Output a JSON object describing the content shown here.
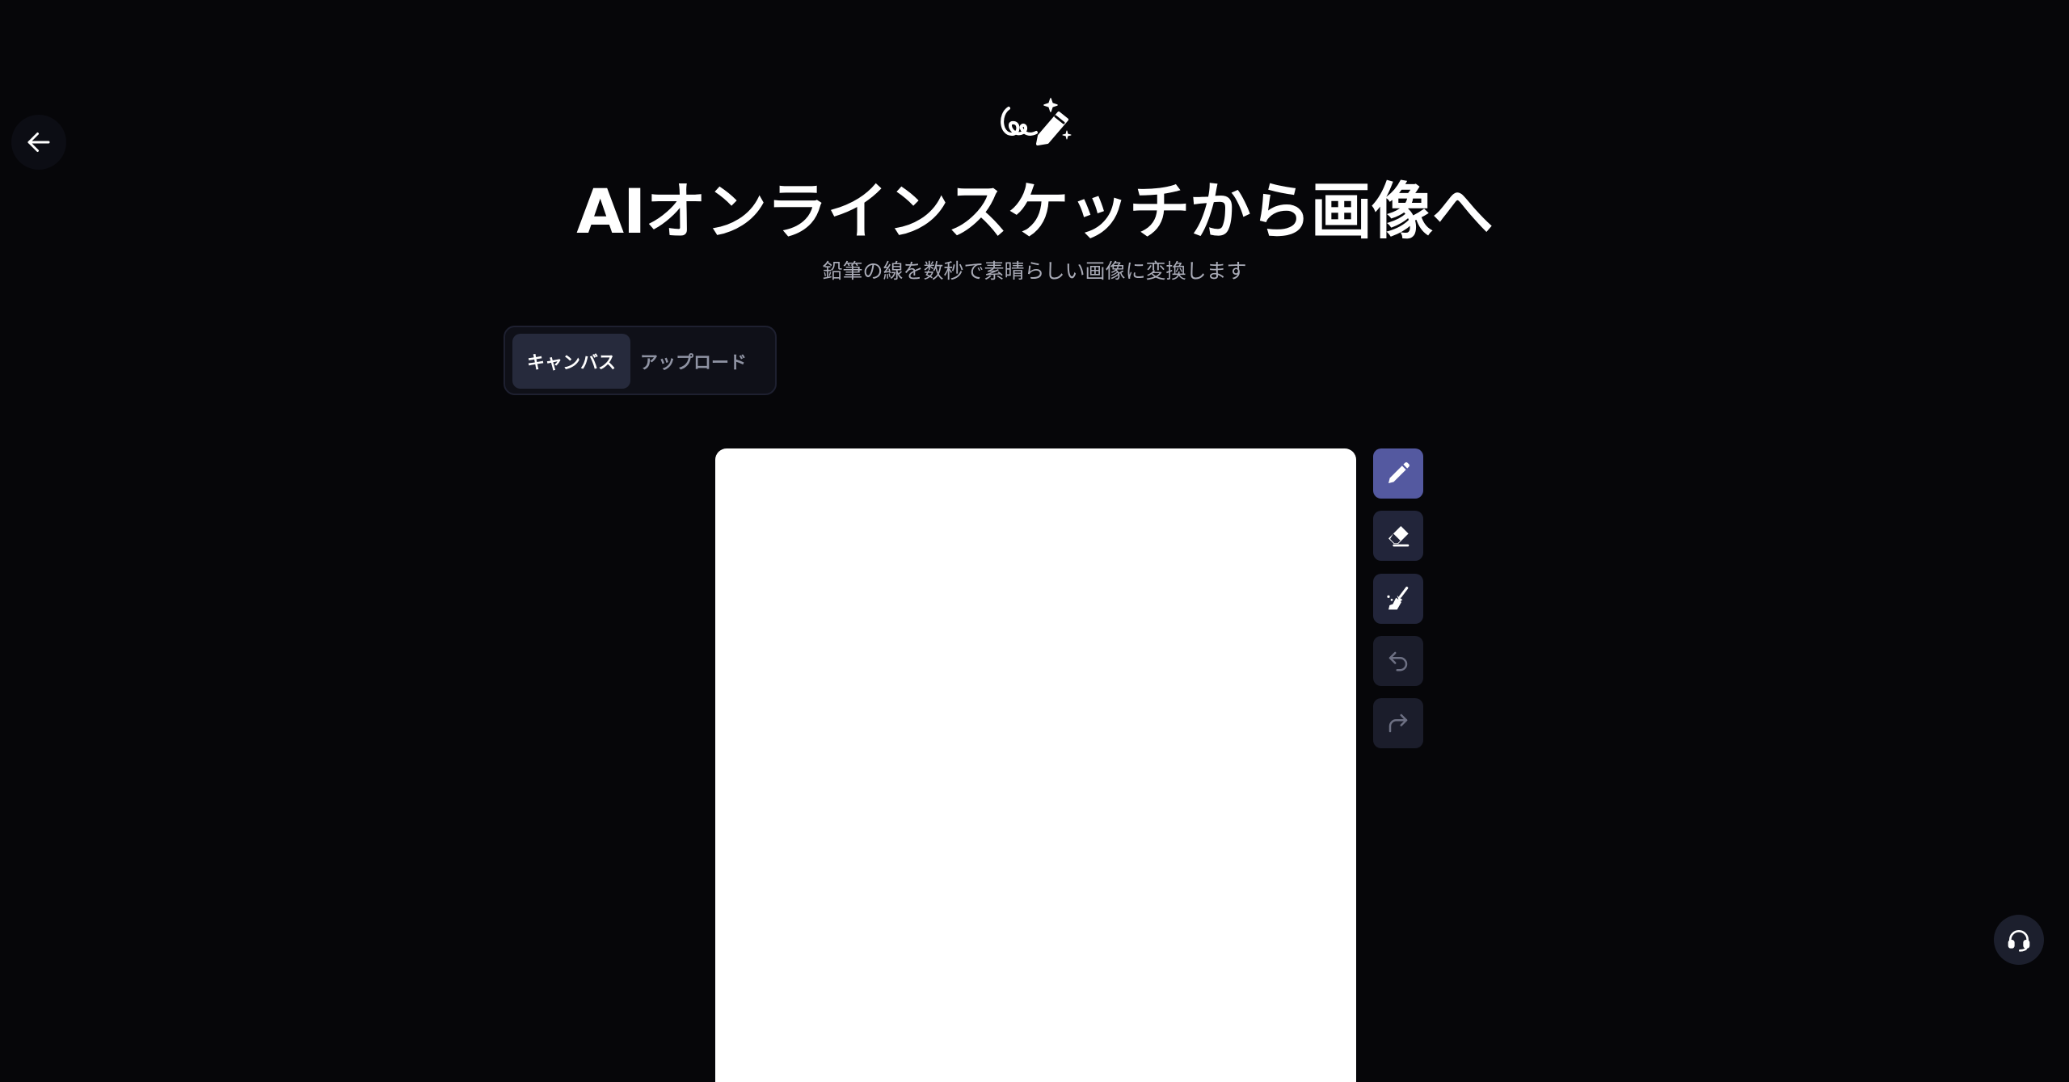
{
  "header": {
    "title": "AIオンラインスケッチから画像へ",
    "subtitle": "鉛筆の線を数秒で素晴らしい画像に変換します"
  },
  "tabs": [
    {
      "label": "キャンバス",
      "active": true
    },
    {
      "label": "アップロード",
      "active": false
    }
  ],
  "toolbar": {
    "tools": [
      {
        "icon": "pencil-icon",
        "active": true,
        "enabled": true
      },
      {
        "icon": "eraser-icon",
        "active": false,
        "enabled": true
      },
      {
        "icon": "broom-icon",
        "active": false,
        "enabled": true
      },
      {
        "icon": "undo-icon",
        "active": false,
        "enabled": false
      },
      {
        "icon": "redo-icon",
        "active": false,
        "enabled": false
      }
    ]
  },
  "icons": {
    "back": "arrow-left-icon",
    "logo": "sketch-logo-icon",
    "support": "headset-icon"
  },
  "colors": {
    "background": "#060609",
    "accent": "#5459a0",
    "tool_bg": "#22253a",
    "canvas": "#ffffff",
    "subtitle": "#a9abb7"
  }
}
